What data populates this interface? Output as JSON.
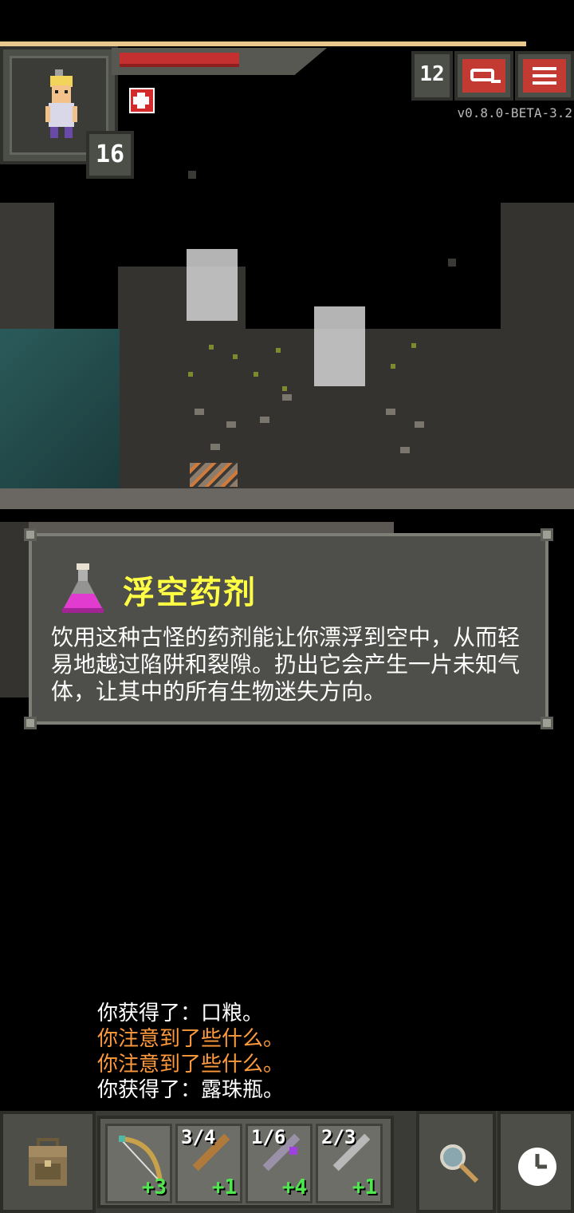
{
  "hud": {
    "hero_level": "16",
    "depth": "12",
    "version": "v0.8.0-BETA-3.2",
    "hp_fraction": 0.75,
    "buff_icon": "buff-icon",
    "journal_icon": "journal-icon",
    "menu_icon": "menu-icon"
  },
  "item_info": {
    "icon": "potion-icon",
    "title": "浮空药剂",
    "description": "饮用这种古怪的药剂能让你漂浮到空中，从而轻易地越过陷阱和裂隙。扔出它会产生一片未知气体，让其中的所有生物迷失方向。"
  },
  "log": [
    {
      "text": "你获得了：口粮。",
      "color": "#ffffff"
    },
    {
      "text": "你注意到了些什么。",
      "color": "#ff9a3c"
    },
    {
      "text": "你注意到了些什么。",
      "color": "#ff9a3c"
    },
    {
      "text": "你获得了：露珠瓶。",
      "color": "#ffffff"
    }
  ],
  "toolbar": {
    "backpack_icon": "backpack-icon",
    "search_icon": "search-icon",
    "wait_icon": "wait-icon",
    "quickslots": [
      {
        "icon": "bow-icon",
        "count": "",
        "upgrade": "+3"
      },
      {
        "icon": "dart-icon",
        "count": "3/4",
        "upgrade": "+1"
      },
      {
        "icon": "wand-icon",
        "count": "1/6",
        "upgrade": "+4"
      },
      {
        "icon": "wand-icon",
        "count": "2/3",
        "upgrade": "+1"
      }
    ]
  }
}
